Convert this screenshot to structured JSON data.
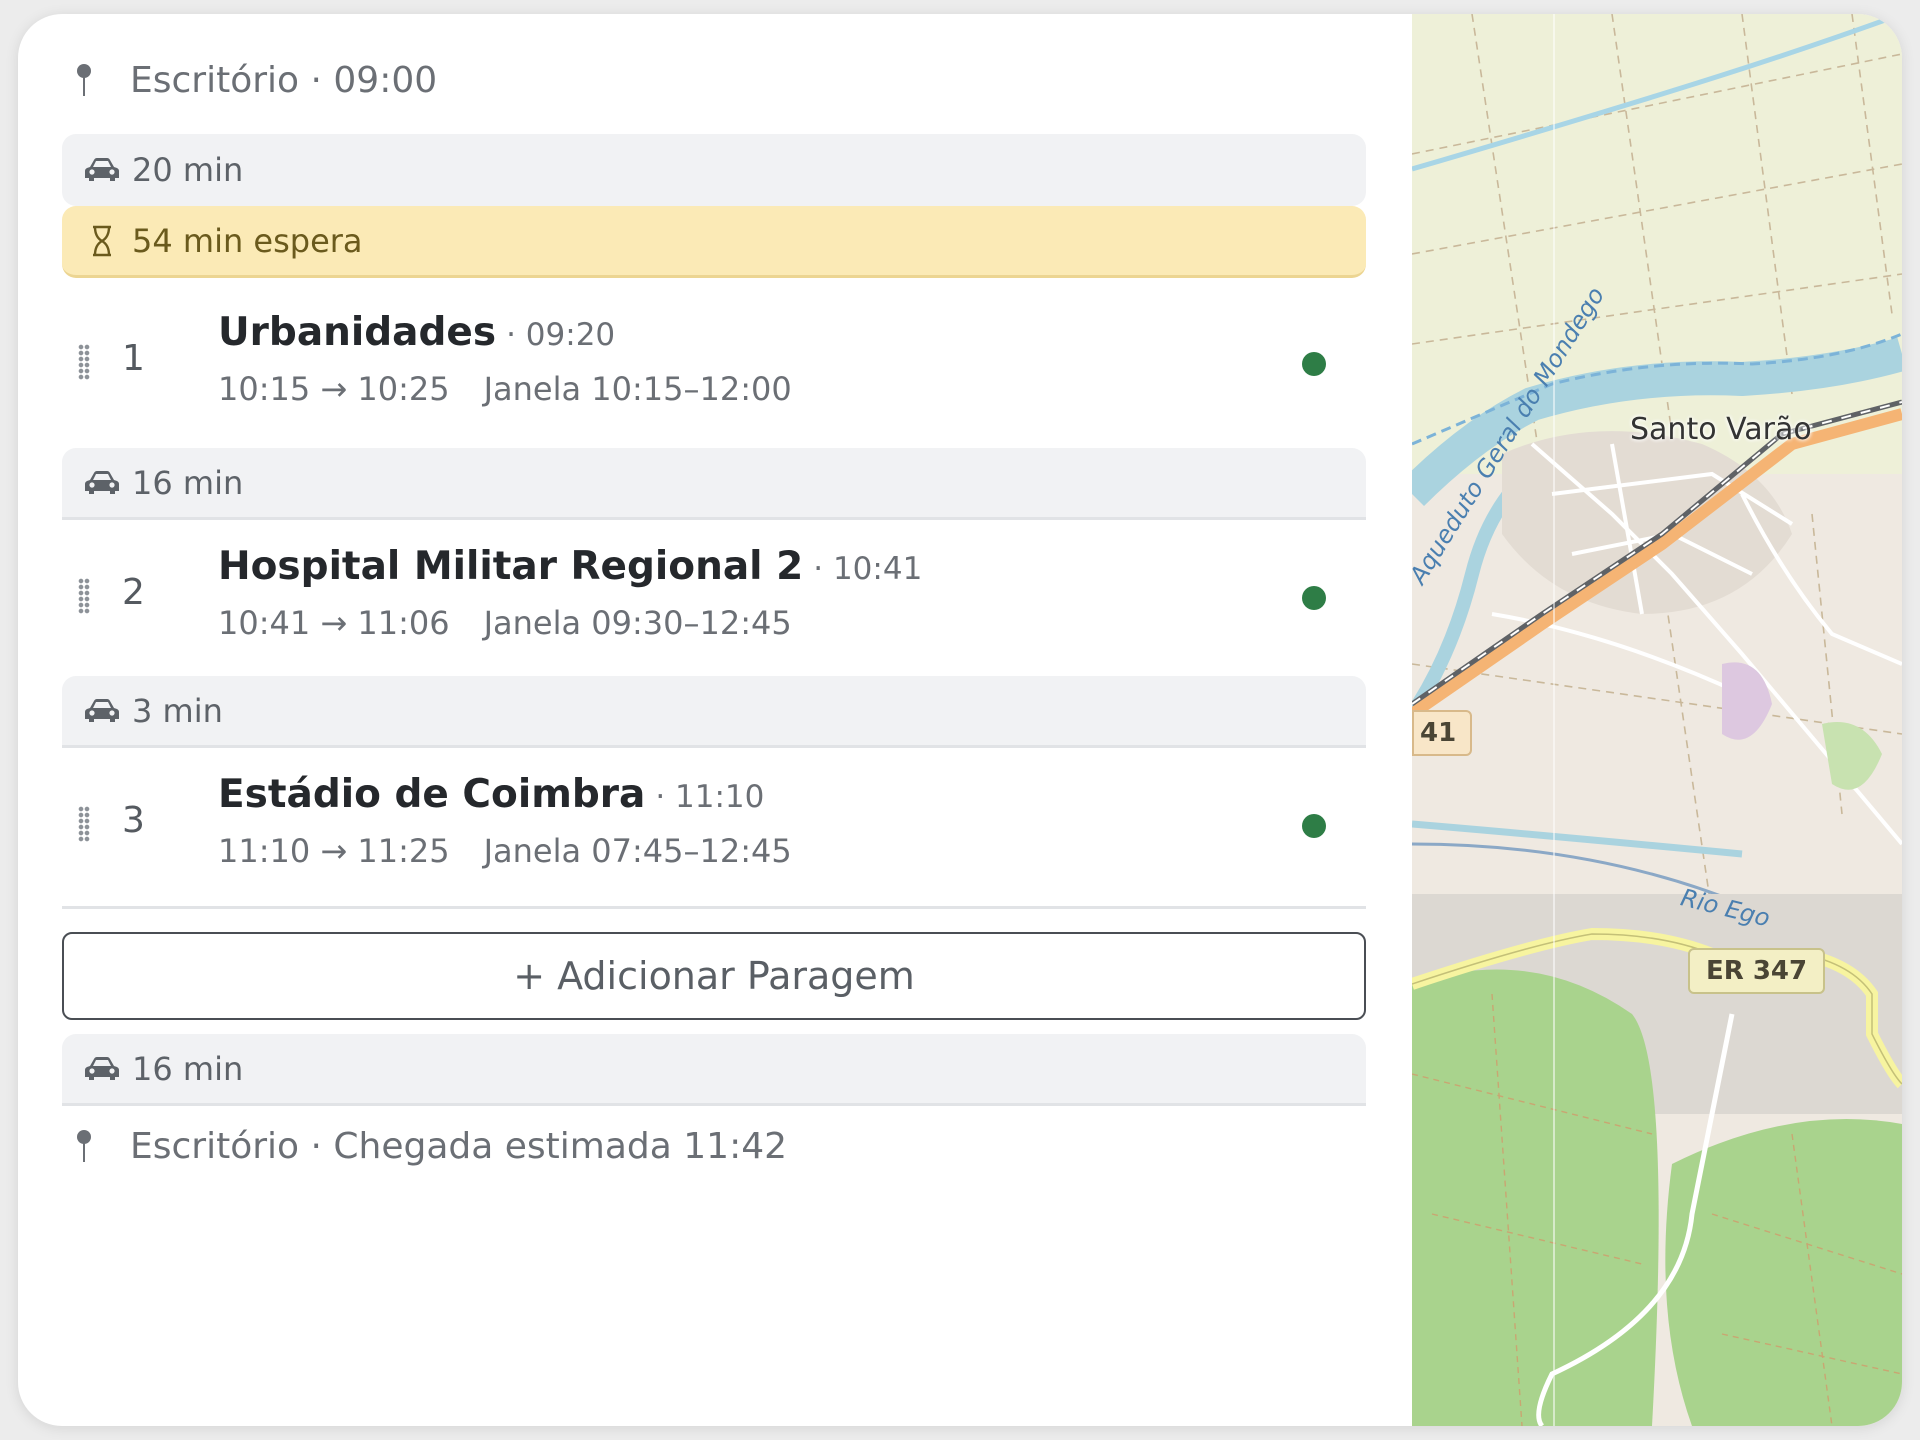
{
  "start": {
    "label": "Escritório · 09:00"
  },
  "legs": {
    "leg1": "20 min",
    "wait": "54 min espera",
    "leg2": "16 min",
    "leg3": "3 min",
    "leg4": "16 min"
  },
  "stops": [
    {
      "number": "1",
      "name": "Urbanidades",
      "eta": "· 09:20",
      "service": "10:15 → 10:25",
      "window": "Janela 10:15–12:00",
      "status_color": "#2e7d46"
    },
    {
      "number": "2",
      "name": "Hospital Militar Regional 2",
      "eta": "· 10:41",
      "service": "10:41 → 11:06",
      "window": "Janela 09:30–12:45",
      "status_color": "#2e7d46"
    },
    {
      "number": "3",
      "name": "Estádio de Coimbra",
      "eta": "· 11:10",
      "service": "11:10 → 11:25",
      "window": "Janela 07:45–12:45",
      "status_color": "#2e7d46"
    }
  ],
  "add_stop_label": "+ Adicionar Paragem",
  "end": {
    "label": "Escritório · Chegada estimada 11:42"
  },
  "map": {
    "place_label": "Santo Varão",
    "river_label": "Rio Ego",
    "canal_label": "Aqueduto Geral do Mondego",
    "road_badge": "ER 347",
    "road_badge_left": "41"
  },
  "icons": {
    "car": "car-icon",
    "hourglass": "hourglass-icon",
    "pin": "map-pin-icon",
    "drag": "drag-handle-icon"
  }
}
